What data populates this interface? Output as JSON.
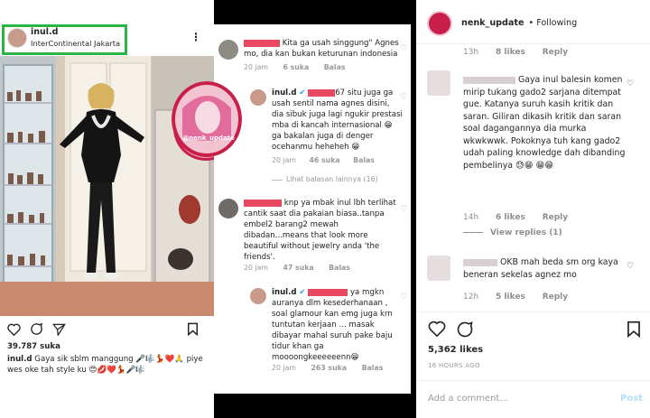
{
  "left_post": {
    "username": "inul.d",
    "location": "InterContinental Jakarta",
    "more_icon": "⋮",
    "likes": "39.787 suka",
    "caption_user": "inul.d",
    "caption": "Gaya sik sblm manggung 🎤🎼💃❤️🙏 piye wes oke tah style ku 😍💋❤️💃🎤🎼"
  },
  "middle": {
    "watermark": "@nenk_update",
    "comments": [
      {
        "text": "Kita ga usah singgung\" Agnes mo, dia kan bukan keturunan indonesia",
        "time": "20 jam",
        "likes": "6 suka",
        "reply": "Balas"
      },
      {
        "user": "inul.d",
        "mention_suffix": "67",
        "text": "situ juga ga usah sentil nama agnes disini, dia sibuk juga lagi ngukir prestasi mba di kancah internasional 😁 ga bakalan juga di denger ocehanmu heheheh 😁",
        "time": "20 jam",
        "likes": "46 suka",
        "reply": "Balas"
      },
      {
        "text": "knp ya mbak inul lbh terlihat cantik saat dia pakaian biasa..tanpa embel2 barang2 mewah dibadan...means that look more beautiful without jewelry anda 'the friends'.",
        "time": "20 jam",
        "likes": "47 suka",
        "reply": "Balas"
      },
      {
        "user": "inul.d",
        "text": "ya mgkn auranya dlm kesederhanaan , soal glamour kan emg juga krn tuntutan kerjaan ... masak dibayar mahal suruh pake baju tidur khan ga moooongkeeeeeenn😁",
        "time": "20 jam",
        "likes": "263 suka",
        "reply": "Balas"
      }
    ],
    "view_replies": "Lihat balasan lainnya (16)"
  },
  "right": {
    "username": "nenk_update",
    "following": "• Following",
    "top_meta": {
      "time": "13h",
      "likes": "8 likes",
      "reply": "Reply"
    },
    "comment1": {
      "text": "Gaya inul balesin komen mirip tukang gado2 sarjana ditempat gue. Katanya suruh kasih kritik dan saran. Giliran dikasih kritik dan saran soal dagangannya dia murka wkwkwwk. Pokoknya tuh kang gado2 udah paling knowledge dah dibanding pembelinya 😓😁 😁😁",
      "time": "14h",
      "likes": "6 likes",
      "reply": "Reply",
      "view_replies": "View replies (1)"
    },
    "comment2": {
      "text": "OKB mah beda sm org kaya beneran sekelas agnez mo",
      "time": "12h",
      "likes": "5 likes",
      "reply": "Reply"
    },
    "likes": "5,362 likes",
    "time_ago": "16 HOURS AGO",
    "add_comment_placeholder": "Add a comment...",
    "post_button": "Post"
  }
}
